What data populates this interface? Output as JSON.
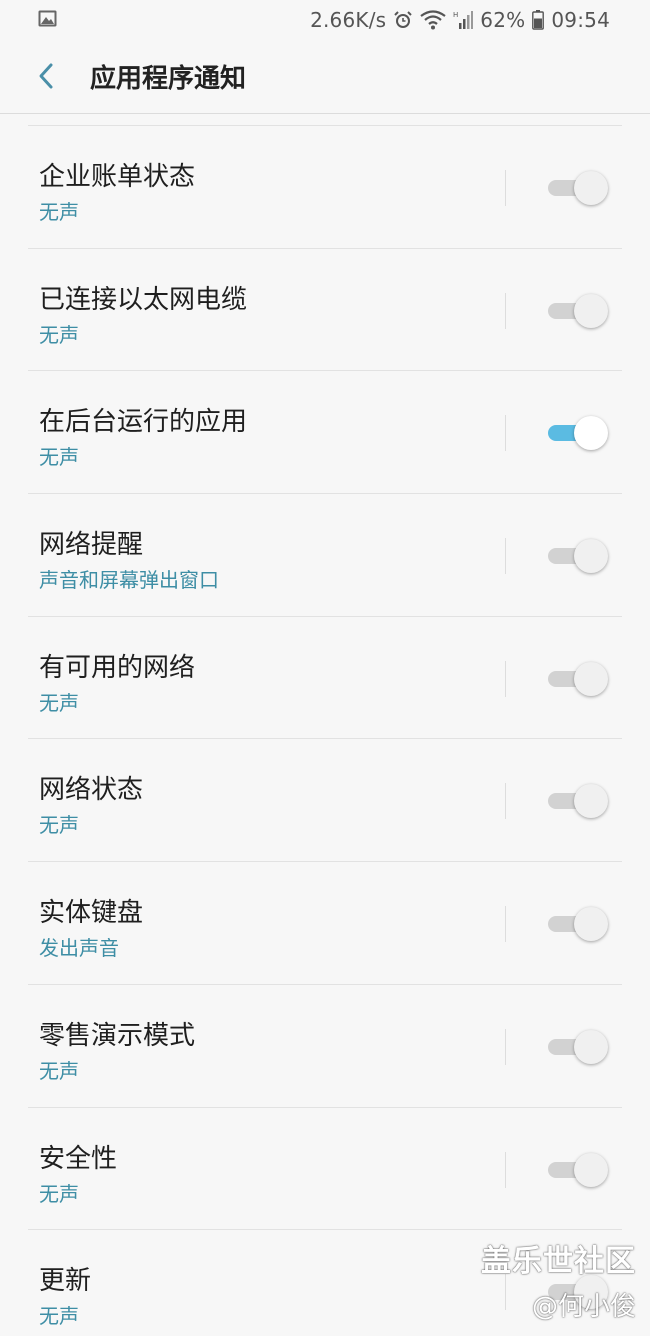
{
  "status_bar": {
    "speed": "2.66K/s",
    "battery": "62%",
    "time": "09:54",
    "icons": [
      "gallery-icon",
      "alarm-icon",
      "wifi-icon",
      "signal-icon",
      "battery-icon"
    ]
  },
  "header": {
    "back_icon": "chevron-left-icon",
    "title": "应用程序通知"
  },
  "items": [
    {
      "title": "企业账单状态",
      "subtitle": "无声",
      "enabled": false
    },
    {
      "title": "已连接以太网电缆",
      "subtitle": "无声",
      "enabled": false
    },
    {
      "title": "在后台运行的应用",
      "subtitle": "无声",
      "enabled": true
    },
    {
      "title": "网络提醒",
      "subtitle": "声音和屏幕弹出窗口",
      "enabled": false
    },
    {
      "title": "有可用的网络",
      "subtitle": "无声",
      "enabled": false
    },
    {
      "title": "网络状态",
      "subtitle": "无声",
      "enabled": false
    },
    {
      "title": "实体键盘",
      "subtitle": "发出声音",
      "enabled": false
    },
    {
      "title": "零售演示模式",
      "subtitle": "无声",
      "enabled": false
    },
    {
      "title": "安全性",
      "subtitle": "无声",
      "enabled": false
    },
    {
      "title": "更新",
      "subtitle": "无声",
      "enabled": false
    }
  ],
  "watermark": {
    "line1": "盖乐世社区",
    "line2": "@何小俊"
  },
  "colors": {
    "accent": "#5bbbe2",
    "subtitle": "#3e8ea5",
    "back": "#4a8fa8"
  }
}
